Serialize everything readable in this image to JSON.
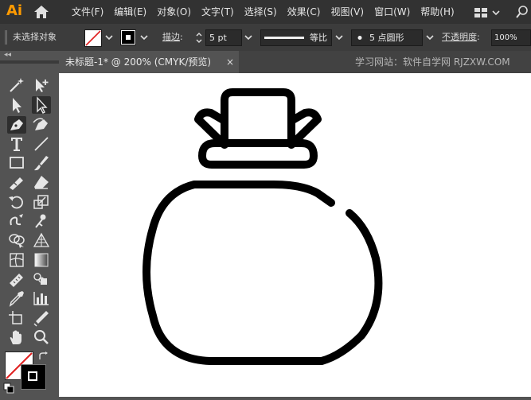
{
  "menubar": {
    "logo": "Ai",
    "menus": [
      "文件(F)",
      "编辑(E)",
      "对象(O)",
      "文字(T)",
      "选择(S)",
      "效果(C)",
      "视图(V)",
      "窗口(W)",
      "帮助(H)"
    ]
  },
  "control": {
    "selection_status": "未选择对象",
    "stroke_label": "描边",
    "stroke_colon": ":",
    "stroke_weight": "5 pt",
    "profile_label": "等比",
    "brush_label": "5 点圆形",
    "opacity_label": "不透明度",
    "opacity_colon": ":",
    "opacity_value": "100%"
  },
  "document": {
    "tab_title": "未标题-1* @ 200% (CMYK/预览)",
    "close_glyph": "×",
    "watermark": "学习网站：软件自学网 RJZXW.COM"
  },
  "toolbar": {
    "collapse_glyph": "◂◂"
  },
  "colors": {
    "accent": "#ff9a00",
    "panel": "#535353",
    "menubar": "#323232",
    "canvas": "#ffffff",
    "stroke": "#000000",
    "none_slash": "#e02020"
  }
}
